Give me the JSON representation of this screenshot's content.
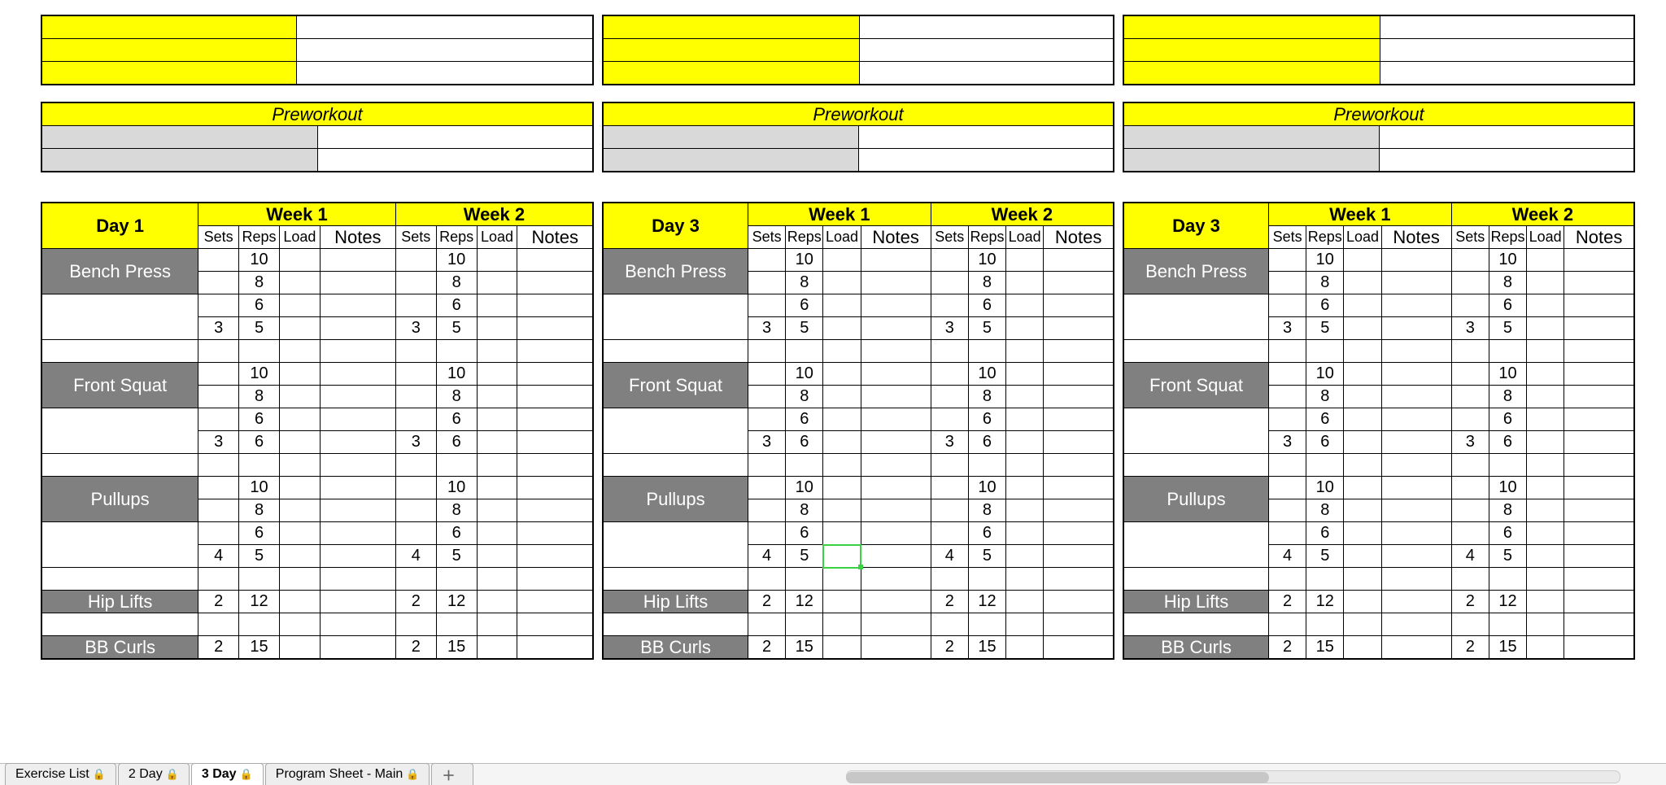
{
  "tabs": [
    {
      "label": "Exercise List",
      "locked": true
    },
    {
      "label": "2 Day",
      "locked": true
    },
    {
      "label": "3 Day",
      "locked": true,
      "active": true
    },
    {
      "label": "Program Sheet - Main",
      "locked": true
    }
  ],
  "preworkout_label": "Preworkout",
  "week1_label": "Week 1",
  "week2_label": "Week 2",
  "hdr_sets": "Sets",
  "hdr_reps": "Reps",
  "hdr_load": "Load",
  "hdr_notes": "Notes",
  "panels": [
    {
      "day_label": "Day 1"
    },
    {
      "day_label": "Day 3"
    },
    {
      "day_label": "Day 3"
    }
  ],
  "exercises": [
    {
      "name": "Bench Press",
      "rows": [
        {
          "sets": "",
          "reps": "10"
        },
        {
          "sets": "",
          "reps": "8"
        },
        {
          "sets": "",
          "reps": "6"
        },
        {
          "sets": "3",
          "reps": "5"
        }
      ]
    },
    {
      "name": "Front Squat",
      "rows": [
        {
          "sets": "",
          "reps": "10"
        },
        {
          "sets": "",
          "reps": "8"
        },
        {
          "sets": "",
          "reps": "6"
        },
        {
          "sets": "3",
          "reps": "6"
        }
      ]
    },
    {
      "name": "Pullups",
      "rows": [
        {
          "sets": "",
          "reps": "10"
        },
        {
          "sets": "",
          "reps": "8"
        },
        {
          "sets": "",
          "reps": "6"
        },
        {
          "sets": "4",
          "reps": "5"
        }
      ]
    },
    {
      "name": "Hip Lifts",
      "rows": [
        {
          "sets": "2",
          "reps": "12"
        }
      ]
    },
    {
      "name": "BB Curls",
      "rows": [
        {
          "sets": "2",
          "reps": "15"
        }
      ]
    }
  ],
  "selected_cell": {
    "panel": 1,
    "exercise_index": 2,
    "row_index": 3,
    "column": "load",
    "week": 1
  }
}
